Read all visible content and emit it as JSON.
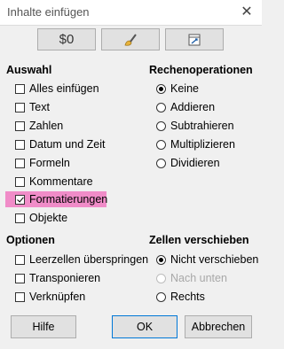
{
  "window": {
    "title": "Inhalte einfügen"
  },
  "presets": {
    "values_only_label": "$0"
  },
  "auswahl": {
    "title": "Auswahl",
    "items": [
      {
        "label": "Alles einfügen",
        "checked": false
      },
      {
        "label": "Text",
        "checked": false
      },
      {
        "label": "Zahlen",
        "checked": false
      },
      {
        "label": "Datum und Zeit",
        "checked": false
      },
      {
        "label": "Formeln",
        "checked": false
      },
      {
        "label": "Kommentare",
        "checked": false
      },
      {
        "label": "Formatierungen",
        "checked": true
      },
      {
        "label": "Objekte",
        "checked": false
      }
    ]
  },
  "rechen": {
    "title": "Rechenoperationen",
    "items": [
      {
        "label": "Keine",
        "checked": true
      },
      {
        "label": "Addieren",
        "checked": false
      },
      {
        "label": "Subtrahieren",
        "checked": false
      },
      {
        "label": "Multiplizieren",
        "checked": false
      },
      {
        "label": "Dividieren",
        "checked": false
      }
    ]
  },
  "optionen": {
    "title": "Optionen",
    "items": [
      {
        "label": "Leerzellen überspringen",
        "checked": false
      },
      {
        "label": "Transponieren",
        "checked": false
      },
      {
        "label": "Verknüpfen",
        "checked": false
      }
    ]
  },
  "zellen": {
    "title": "Zellen verschieben",
    "items": [
      {
        "label": "Nicht verschieben",
        "checked": true,
        "disabled": false
      },
      {
        "label": "Nach unten",
        "checked": false,
        "disabled": true
      },
      {
        "label": "Rechts",
        "checked": false,
        "disabled": false
      }
    ]
  },
  "buttons": {
    "help": "Hilfe",
    "ok": "OK",
    "cancel": "Abbrechen"
  }
}
